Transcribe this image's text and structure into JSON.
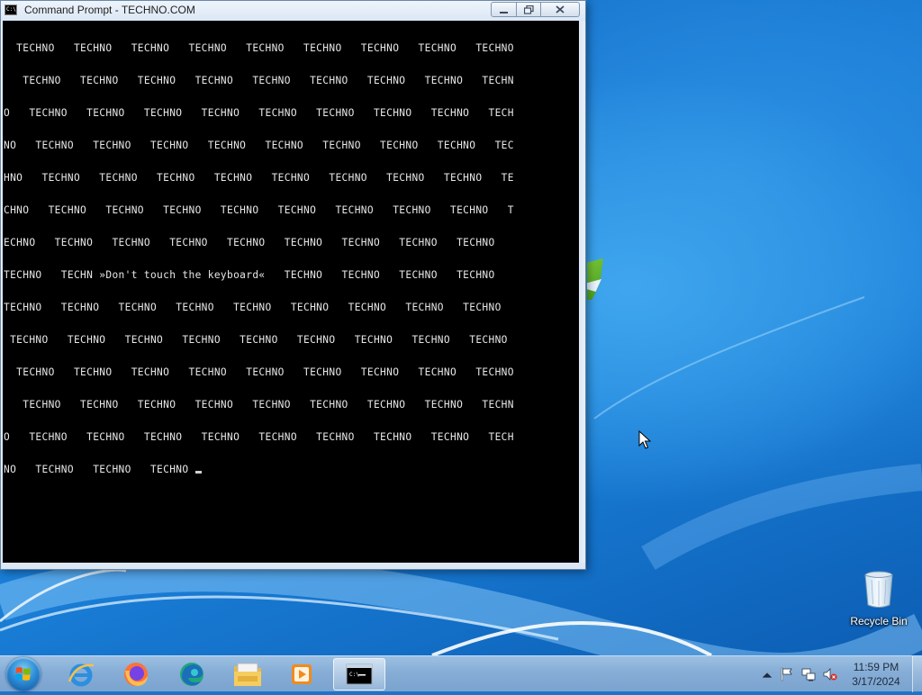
{
  "window": {
    "title": "Command Prompt - TECHNO.COM",
    "icon": "cmd-icon",
    "controls": {
      "minimize": "minimize-icon",
      "maximize": "restore-icon",
      "close": "close-icon"
    }
  },
  "console": {
    "lines": [
      "  TECHNO   TECHNO   TECHNO   TECHNO   TECHNO   TECHNO   TECHNO   TECHNO   TECHNO",
      "   TECHNO   TECHNO   TECHNO   TECHNO   TECHNO   TECHNO   TECHNO   TECHNO   TECHN",
      "O   TECHNO   TECHNO   TECHNO   TECHNO   TECHNO   TECHNO   TECHNO   TECHNO   TECH",
      "NO   TECHNO   TECHNO   TECHNO   TECHNO   TECHNO   TECHNO   TECHNO   TECHNO   TEC",
      "HNO   TECHNO   TECHNO   TECHNO   TECHNO   TECHNO   TECHNO   TECHNO   TECHNO   TE",
      "CHNO   TECHNO   TECHNO   TECHNO   TECHNO   TECHNO   TECHNO   TECHNO   TECHNO   T",
      "ECHNO   TECHNO   TECHNO   TECHNO   TECHNO   TECHNO   TECHNO   TECHNO   TECHNO",
      "TECHNO   TECHN »Don't touch the keyboard«   TECHNO   TECHNO   TECHNO   TECHNO",
      "TECHNO   TECHNO   TECHNO   TECHNO   TECHNO   TECHNO   TECHNO   TECHNO   TECHNO",
      " TECHNO   TECHNO   TECHNO   TECHNO   TECHNO   TECHNO   TECHNO   TECHNO   TECHNO",
      "  TECHNO   TECHNO   TECHNO   TECHNO   TECHNO   TECHNO   TECHNO   TECHNO   TECHNO",
      "   TECHNO   TECHNO   TECHNO   TECHNO   TECHNO   TECHNO   TECHNO   TECHNO   TECHN",
      "O   TECHNO   TECHNO   TECHNO   TECHNO   TECHNO   TECHNO   TECHNO   TECHNO   TECH",
      "NO   TECHNO   TECHNO   TECHNO "
    ]
  },
  "desktop": {
    "recycle_bin_label": "Recycle Bin"
  },
  "taskbar": {
    "start": "windows-start-orb-icon",
    "pinned": [
      {
        "name": "internet-explorer-icon"
      },
      {
        "name": "firefox-icon"
      },
      {
        "name": "edge-icon"
      },
      {
        "name": "file-explorer-icon"
      },
      {
        "name": "media-player-icon"
      },
      {
        "name": "command-prompt-icon",
        "active": true
      }
    ],
    "tray": {
      "icons": [
        "show-hidden-icons-chevron-icon",
        "action-center-flag-icon",
        "network-icon",
        "volume-muted-icon"
      ],
      "time": "11:59 PM",
      "date": "3/17/2024"
    }
  }
}
